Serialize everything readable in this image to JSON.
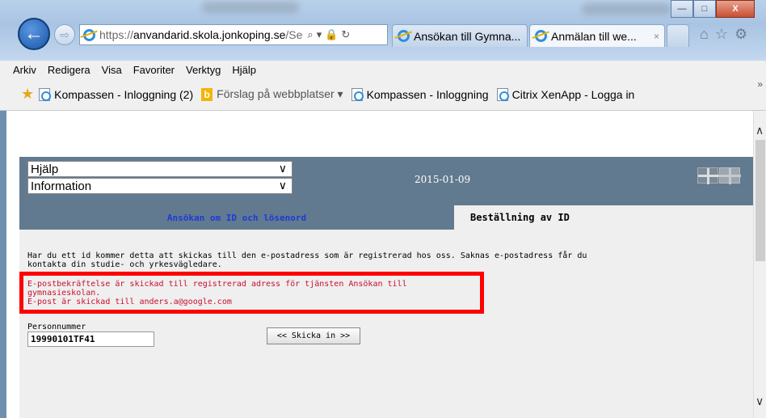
{
  "browser": {
    "url_prefix": "https://",
    "url_domain": "anvandarid.skola.jonkoping.se",
    "url_suffix": "/Se",
    "tabs": [
      {
        "label": "Ansökan till Gymna..."
      },
      {
        "label": "Anmälan till we...",
        "close": "×"
      }
    ],
    "window_controls": {
      "minimize": "—",
      "maximize": "□",
      "close": "X"
    },
    "icons": [
      "back-icon",
      "forward-icon",
      "home-icon",
      "star-icon",
      "gear-icon"
    ]
  },
  "menu": [
    "Arkiv",
    "Redigera",
    "Visa",
    "Favoriter",
    "Verktyg",
    "Hjälp"
  ],
  "favorites": [
    {
      "label": "Kompassen - Inloggning (2)"
    },
    {
      "label": "Förslag på webbplatser ▾"
    },
    {
      "label": "Kompassen - Inloggning"
    },
    {
      "label": "Citrix XenApp - Logga in"
    }
  ],
  "page": {
    "select_help": "Hjälp",
    "select_info": "Information",
    "date": "2015-01-09",
    "tab_apply": "Ansökan om ID och lösenord",
    "tab_order": "Beställning av ID",
    "message": "Har du ett id kommer detta att skickas till den e-postadress som är registrerad hos oss. Saknas e-postadress får du kontakta din studie- och yrkesvägledare.",
    "confirm_line1": "E-postbekräftelse är skickad till registrerad adress för tjänsten Ansökan till gymnasieskolan.",
    "confirm_line2": "E-post är skickad till anders.a@google.com",
    "personnummer_label": "Personnummer",
    "personnummer_value": "19990101TF41",
    "submit_label": "<< Skicka in >>"
  },
  "colors": {
    "header_band": "#627a8f",
    "tab_link": "#1e3ad8",
    "error_text": "#c8102e",
    "highlight_box": "#ff0000"
  }
}
